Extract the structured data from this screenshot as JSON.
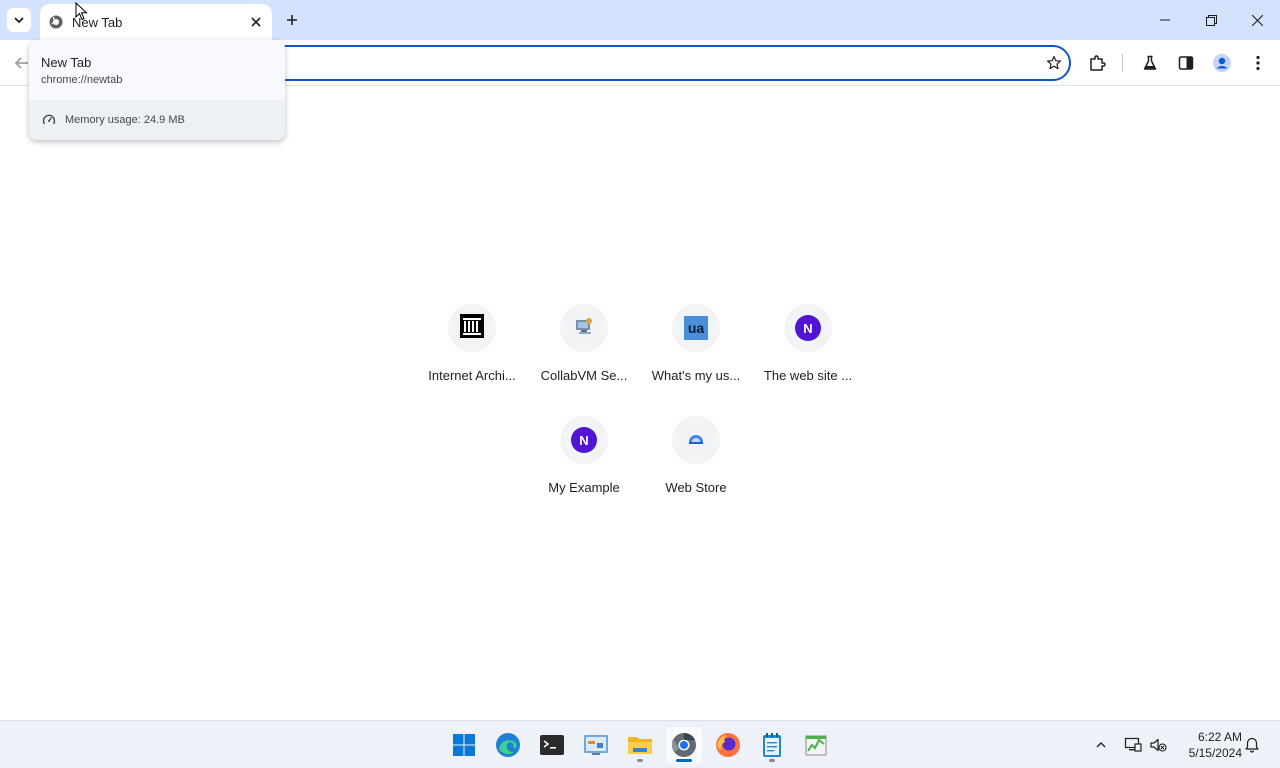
{
  "tab": {
    "title": "New Tab",
    "url": "chrome://newtab",
    "memory": "Memory usage: 24.9 MB"
  },
  "omnibox": {
    "value": "",
    "placeholder": ""
  },
  "shortcuts": [
    {
      "label": "Internet Archi...",
      "icon": "internet-archive-icon"
    },
    {
      "label": "CollabVM Se...",
      "icon": "collabvm-icon"
    },
    {
      "label": "What's my us...",
      "icon": "ua-icon",
      "icon_text": "ua"
    },
    {
      "label": "The web site ...",
      "icon": "n-letter-icon",
      "icon_text": "N"
    },
    {
      "label": "My Example",
      "icon": "n-letter-icon",
      "icon_text": "N"
    },
    {
      "label": "Web Store",
      "icon": "web-store-icon"
    }
  ],
  "taskbar": {
    "apps": [
      "start",
      "edge",
      "terminal",
      "control-panel",
      "file-explorer",
      "chrome",
      "firefox",
      "notepad",
      "task-manager"
    ],
    "time": "6:22 AM",
    "date": "5/15/2024"
  },
  "colors": {
    "tabstrip": "#d3e3fd",
    "accent": "#0b57d0",
    "badge": "#5214d6"
  }
}
